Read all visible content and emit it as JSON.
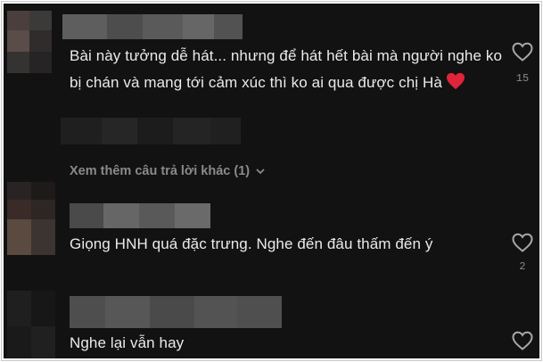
{
  "comments": [
    {
      "text": "Bài này tưởng dễ hát... nhưng để hát hết bài mà người nghe ko bị chán và mang tới cảm xúc thì ko ai qua được chị Hà",
      "emoji": "red-heart-emoji",
      "like_count": "15"
    },
    {
      "text": "Giọng HNH quá đặc trưng. Nghe đến đâu thấm đến ý",
      "like_count": "2"
    },
    {
      "text": "Nghe lại vẫn hay"
    }
  ],
  "view_more_replies": "Xem thêm câu trả lời khác (1)",
  "icons": {
    "like": "heart-outline-icon",
    "expand": "chevron-down-icon"
  },
  "colors": {
    "background": "#121212",
    "text": "#eaeaea",
    "muted": "#8a8a8a",
    "emoji": "#e0243a"
  }
}
